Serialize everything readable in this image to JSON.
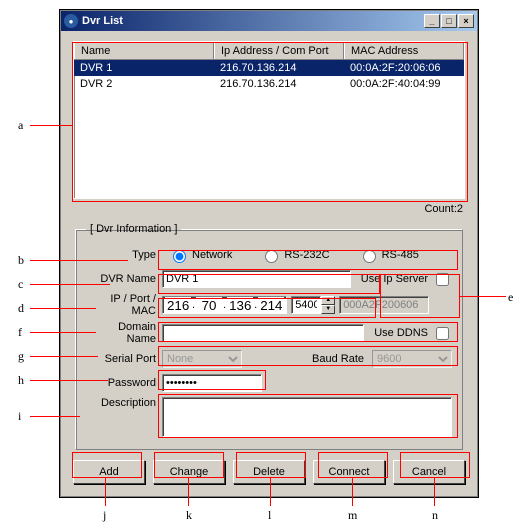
{
  "window": {
    "title": "Dvr List"
  },
  "list": {
    "columns": {
      "name": "Name",
      "ip": "Ip Address / Com Port",
      "mac": "MAC Address"
    },
    "rows": [
      {
        "name": "DVR 1",
        "ip": "216.70.136.214",
        "mac": "00:0A:2F:20:06:06",
        "selected": true
      },
      {
        "name": "DVR 2",
        "ip": "216.70.136.214",
        "mac": "00:0A:2F:40:04:99",
        "selected": false
      }
    ],
    "count_label": "Count:2"
  },
  "group": {
    "legend": "[ Dvr Information ]"
  },
  "labels": {
    "type": "Type",
    "dvrname": "DVR Name",
    "ipportmac": "IP / Port / MAC",
    "domain": "Domain Name",
    "serial": "Serial Port",
    "baud": "Baud Rate",
    "password": "Password",
    "description": "Description",
    "useipserver": "Use Ip Server",
    "useddns": "Use DDNS"
  },
  "type_options": {
    "network": "Network",
    "rs232c": "RS-232C",
    "rs485": "RS-485",
    "selected": "network"
  },
  "values": {
    "dvrname": "DVR 1",
    "ip": [
      "216",
      "70",
      "136",
      "214"
    ],
    "port": "5400",
    "mac": "000A2F200606",
    "domain": "",
    "serial": "None",
    "baud": "9600",
    "password": "********"
  },
  "buttons": {
    "add": "Add",
    "change": "Change",
    "delete": "Delete",
    "connect": "Connect",
    "cancel": "Cancel"
  },
  "callouts": {
    "a": "a",
    "b": "b",
    "c": "c",
    "d": "d",
    "e": "e",
    "f": "f",
    "g": "g",
    "h": "h",
    "i": "i",
    "j": "j",
    "k": "k",
    "l": "l",
    "m": "m",
    "n": "n"
  }
}
